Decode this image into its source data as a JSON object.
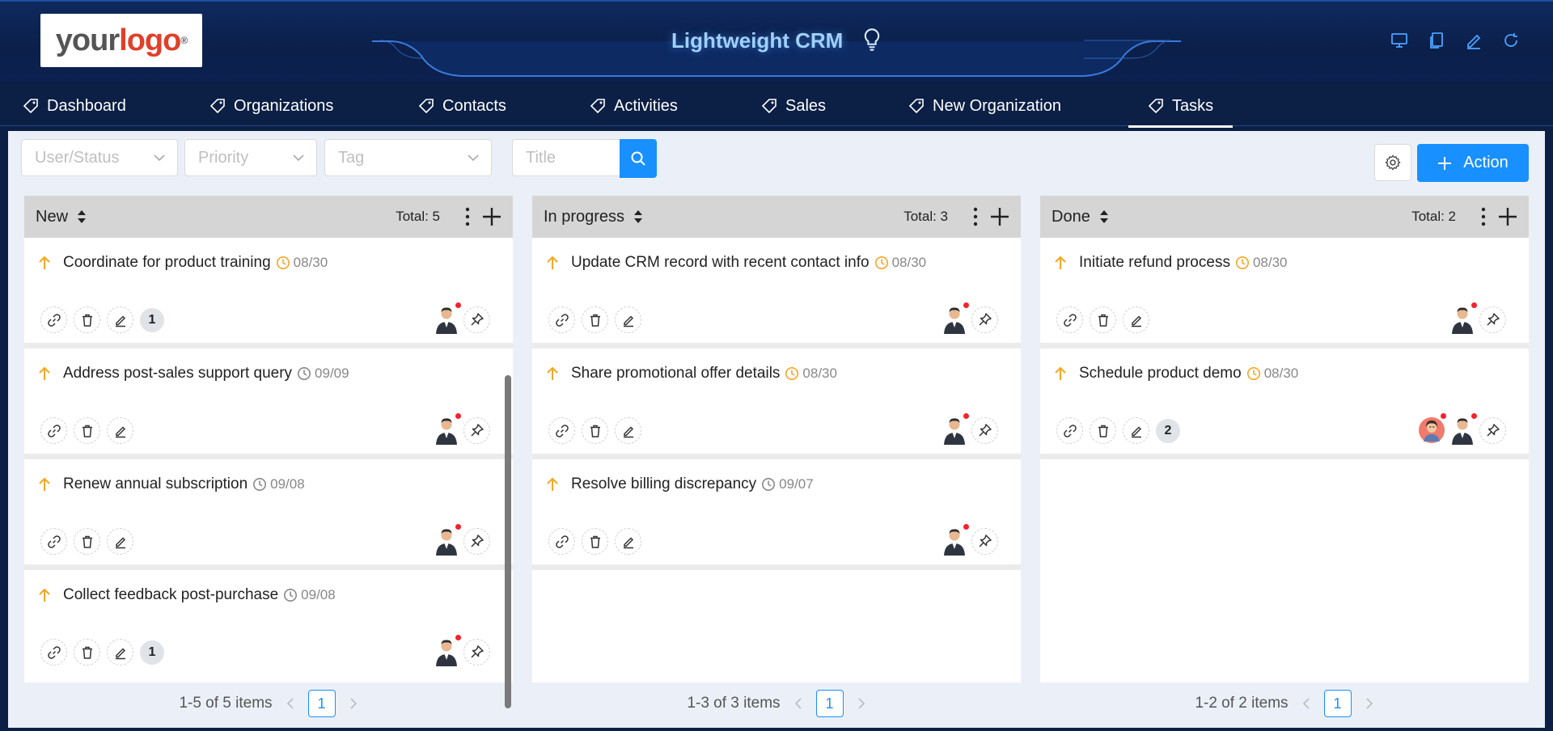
{
  "header": {
    "logo": {
      "your": "your",
      "logo": "logo",
      "reg": "®"
    },
    "title": "Lightweight CRM",
    "icons": [
      "monitor-icon",
      "copy-icon",
      "edit-icon",
      "refresh-icon"
    ]
  },
  "nav": {
    "items": [
      {
        "label": "Dashboard"
      },
      {
        "label": "Organizations"
      },
      {
        "label": "Contacts"
      },
      {
        "label": "Activities"
      },
      {
        "label": "Sales"
      },
      {
        "label": "New Organization"
      },
      {
        "label": "Tasks",
        "active": true
      }
    ]
  },
  "filters": {
    "user_status": "User/Status",
    "priority": "Priority",
    "tag": "Tag",
    "title": "Title"
  },
  "toolbar": {
    "action_label": "Action"
  },
  "columns": [
    {
      "name": "New",
      "total": "Total: 5",
      "pager": "1-5 of 5 items",
      "page": "1",
      "cards": [
        {
          "title": "Coordinate for product training",
          "date": "08/30",
          "due": "warning",
          "count": "1"
        },
        {
          "title": "Address post-sales support query",
          "date": "09/09",
          "due": "normal",
          "count": ""
        },
        {
          "title": "Renew annual subscription",
          "date": "09/08",
          "due": "normal",
          "count": ""
        },
        {
          "title": "Collect feedback post-purchase",
          "date": "09/08",
          "due": "normal",
          "count": "1"
        }
      ]
    },
    {
      "name": "In progress",
      "total": "Total: 3",
      "pager": "1-3 of 3 items",
      "page": "1",
      "cards": [
        {
          "title": "Update CRM record with recent contact info",
          "date": "08/30",
          "due": "warning",
          "count": ""
        },
        {
          "title": "Share promotional offer details",
          "date": "08/30",
          "due": "warning",
          "count": ""
        },
        {
          "title": "Resolve billing discrepancy",
          "date": "09/07",
          "due": "normal",
          "count": ""
        }
      ]
    },
    {
      "name": "Done",
      "total": "Total: 2",
      "pager": "1-2 of 2 items",
      "page": "1",
      "cards": [
        {
          "title": "Initiate refund process",
          "date": "08/30",
          "due": "warning",
          "count": ""
        },
        {
          "title": "Schedule product demo",
          "date": "08/30",
          "due": "warning",
          "count": "2",
          "extra_avatar": true
        }
      ]
    }
  ],
  "colors": {
    "primary": "#1890ff",
    "priority_arrow": "#f5a623",
    "due_warning": "#f5a623",
    "header_bg": "#0b1f4a",
    "title_glow": "#9fd1ff"
  }
}
